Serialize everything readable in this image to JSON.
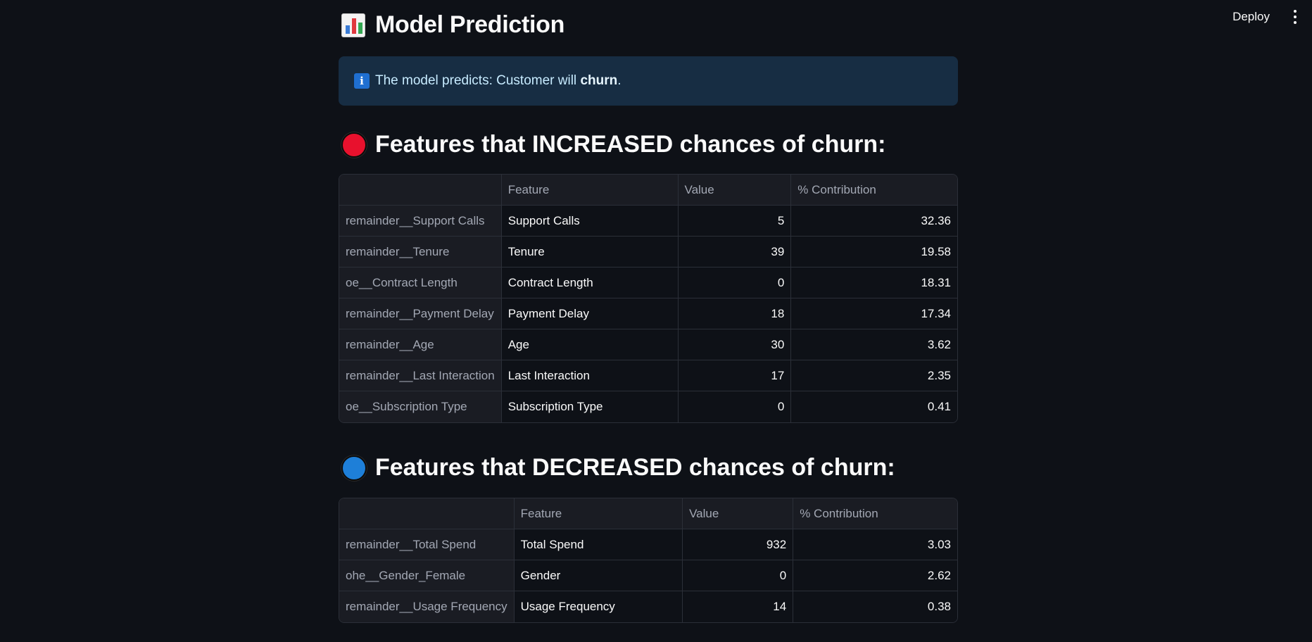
{
  "header": {
    "deploy_label": "Deploy",
    "menu_icon": "vertical-ellipsis-icon"
  },
  "page": {
    "title": "Model Prediction",
    "title_icon": "bar-chart-icon"
  },
  "info": {
    "icon": "info-icon",
    "prefix": "The model predicts: Customer will ",
    "emphasis": "churn",
    "suffix": "."
  },
  "increased": {
    "heading": "Features that INCREASED chances of churn:",
    "dot_color": "#e8112d",
    "columns": [
      "",
      "Feature",
      "Value",
      "% Contribution"
    ],
    "rows": [
      {
        "index": "remainder__Support Calls",
        "feature": "Support Calls",
        "value": "5",
        "contribution": "32.36"
      },
      {
        "index": "remainder__Tenure",
        "feature": "Tenure",
        "value": "39",
        "contribution": "19.58"
      },
      {
        "index": "oe__Contract Length",
        "feature": "Contract Length",
        "value": "0",
        "contribution": "18.31"
      },
      {
        "index": "remainder__Payment Delay",
        "feature": "Payment Delay",
        "value": "18",
        "contribution": "17.34"
      },
      {
        "index": "remainder__Age",
        "feature": "Age",
        "value": "30",
        "contribution": "3.62"
      },
      {
        "index": "remainder__Last Interaction",
        "feature": "Last Interaction",
        "value": "17",
        "contribution": "2.35"
      },
      {
        "index": "oe__Subscription Type",
        "feature": "Subscription Type",
        "value": "0",
        "contribution": "0.41"
      }
    ]
  },
  "decreased": {
    "heading": "Features that DECREASED chances of churn:",
    "dot_color": "#1e7fd8",
    "columns": [
      "",
      "Feature",
      "Value",
      "% Contribution"
    ],
    "rows": [
      {
        "index": "remainder__Total Spend",
        "feature": "Total Spend",
        "value": "932",
        "contribution": "3.03"
      },
      {
        "index": "ohe__Gender_Female",
        "feature": "Gender",
        "value": "0",
        "contribution": "2.62"
      },
      {
        "index": "remainder__Usage Frequency",
        "feature": "Usage Frequency",
        "value": "14",
        "contribution": "0.38"
      }
    ]
  }
}
